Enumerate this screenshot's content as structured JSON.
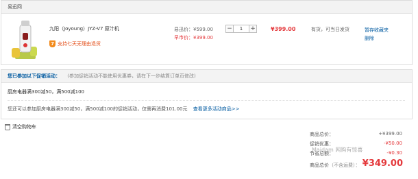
{
  "seller": {
    "name": "易迅网"
  },
  "item": {
    "name": "九阳（Joyoung）JYZ-V7 原汁机",
    "guarantee_text": "支持七天无理由退货",
    "badge_text": "7",
    "price_label": "易迅价：¥599.00",
    "group_price_label": "早市价：¥399.00",
    "quantity": "1",
    "minus": "−",
    "plus": "+",
    "subtotal": "¥399.00",
    "stock": "有货，可当日发货",
    "action_favorite": "暂存收藏夹",
    "action_delete": "删除"
  },
  "promo": {
    "title": "您已参加以下促销活动：",
    "note": "(参加促销活动不能使用优惠券，请在下一步结算订单页修改)",
    "line1": "厨房电器满300减50，满500减100",
    "line2": "您还可以参加厨房电器满300减50，满500减100的促销活动，仅需再消费101.00元",
    "link": "查看更多活动商品>>"
  },
  "clear_cart": "清空购物车",
  "summary": {
    "rows": [
      {
        "label": "商品总价：",
        "value": "+¥399.00"
      },
      {
        "label": "促销优惠：",
        "value": "-¥50.00"
      },
      {
        "label": "节省总额：",
        "value": "-¥0.30"
      }
    ],
    "total_label": "商品总价",
    "total_note": "（不含运费）：",
    "total_value": "¥349.00"
  },
  "watermark": "Maidam 网购有惊喜"
}
